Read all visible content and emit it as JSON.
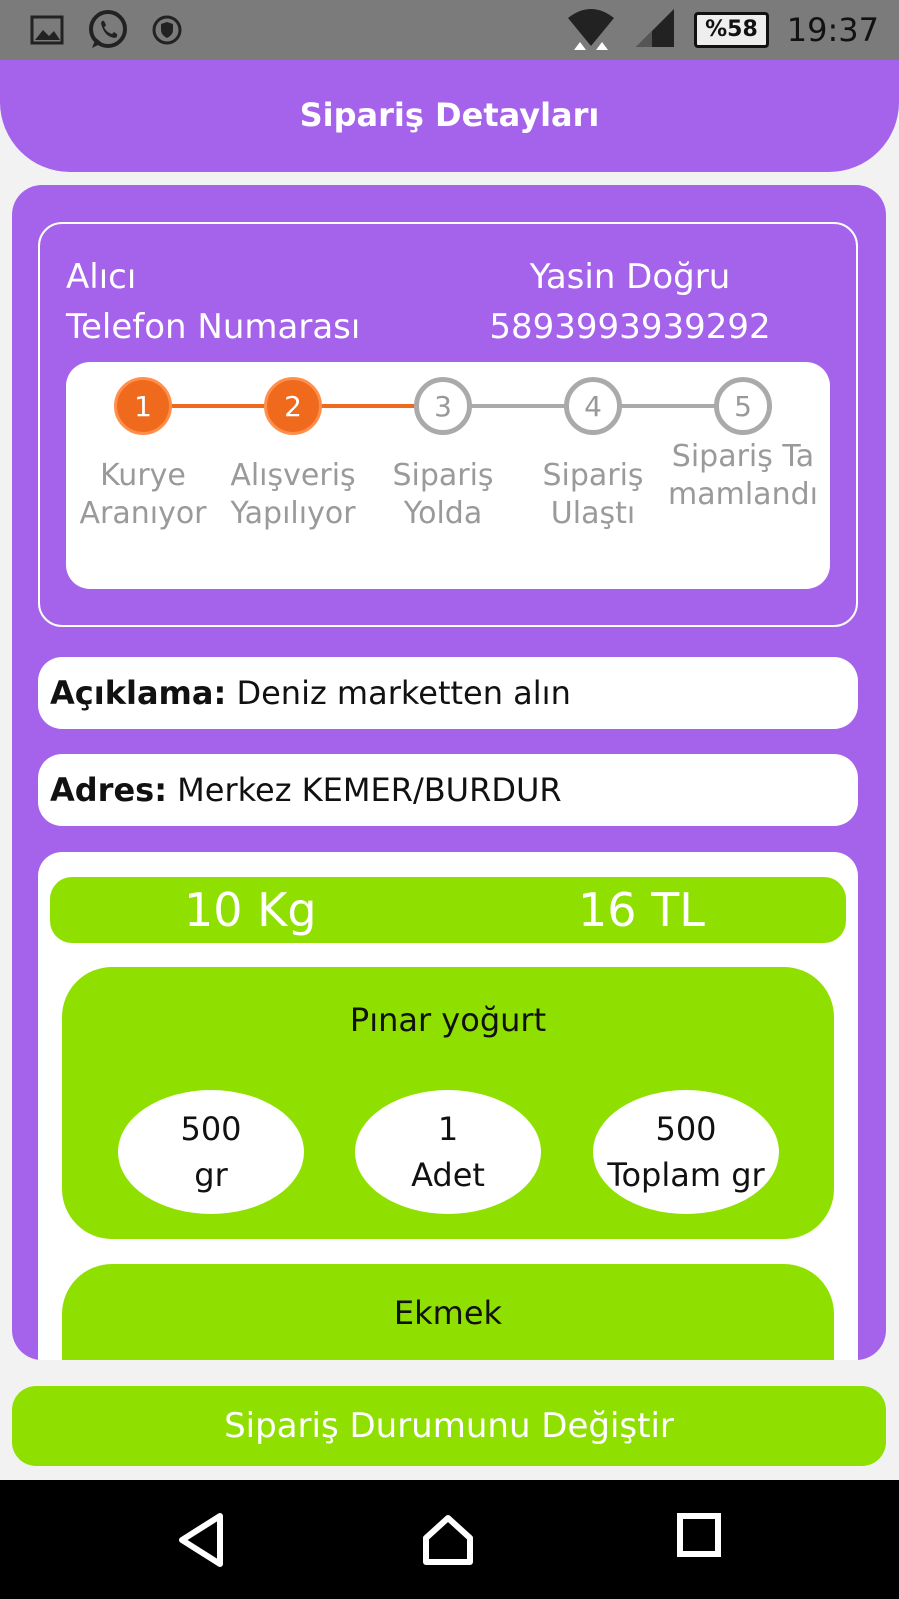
{
  "status_bar": {
    "battery": "%58",
    "time": "19:37",
    "icons": [
      "image-icon",
      "whatsapp-icon",
      "shield-icon",
      "wifi-icon",
      "signal-icon",
      "battery-icon"
    ]
  },
  "header": {
    "title": "Sipariş Detayları"
  },
  "order": {
    "recipient_label": "Alıcı",
    "recipient_name": "Yasin Doğru",
    "phone_label": "Telefon Numarası",
    "phone_value": "5893993939292"
  },
  "steps": [
    {
      "number": "1",
      "label": "Kurye Aranıyor",
      "state": "done"
    },
    {
      "number": "2",
      "label": "Alışveriş Yapılıyor",
      "state": "done"
    },
    {
      "number": "3",
      "label": "Sipariş Yolda",
      "state": "todo"
    },
    {
      "number": "4",
      "label": "Sipariş Ulaştı",
      "state": "todo"
    },
    {
      "number": "5",
      "label": "Sipariş Tamamlandı",
      "state": "todo"
    }
  ],
  "note": {
    "label": "Açıklama:",
    "value": "Deniz marketten alın"
  },
  "address": {
    "label": "Adres:",
    "value": "Merkez KEMER/BURDUR"
  },
  "summary": {
    "weight": "10 Kg",
    "price": "16 TL"
  },
  "products": [
    {
      "name": "Pınar yoğurt",
      "unit_amount": "500",
      "unit": "gr",
      "count": "1",
      "count_label": "Adet",
      "total": "500",
      "total_label": "Toplam gr"
    },
    {
      "name": "Ekmek"
    }
  ],
  "action_button": "Sipariş Durumunu Değiştir",
  "colors": {
    "purple": "#a463ea",
    "green": "#8fe000",
    "orange": "#f06a1e",
    "statusbar": "#7b7b7b"
  }
}
